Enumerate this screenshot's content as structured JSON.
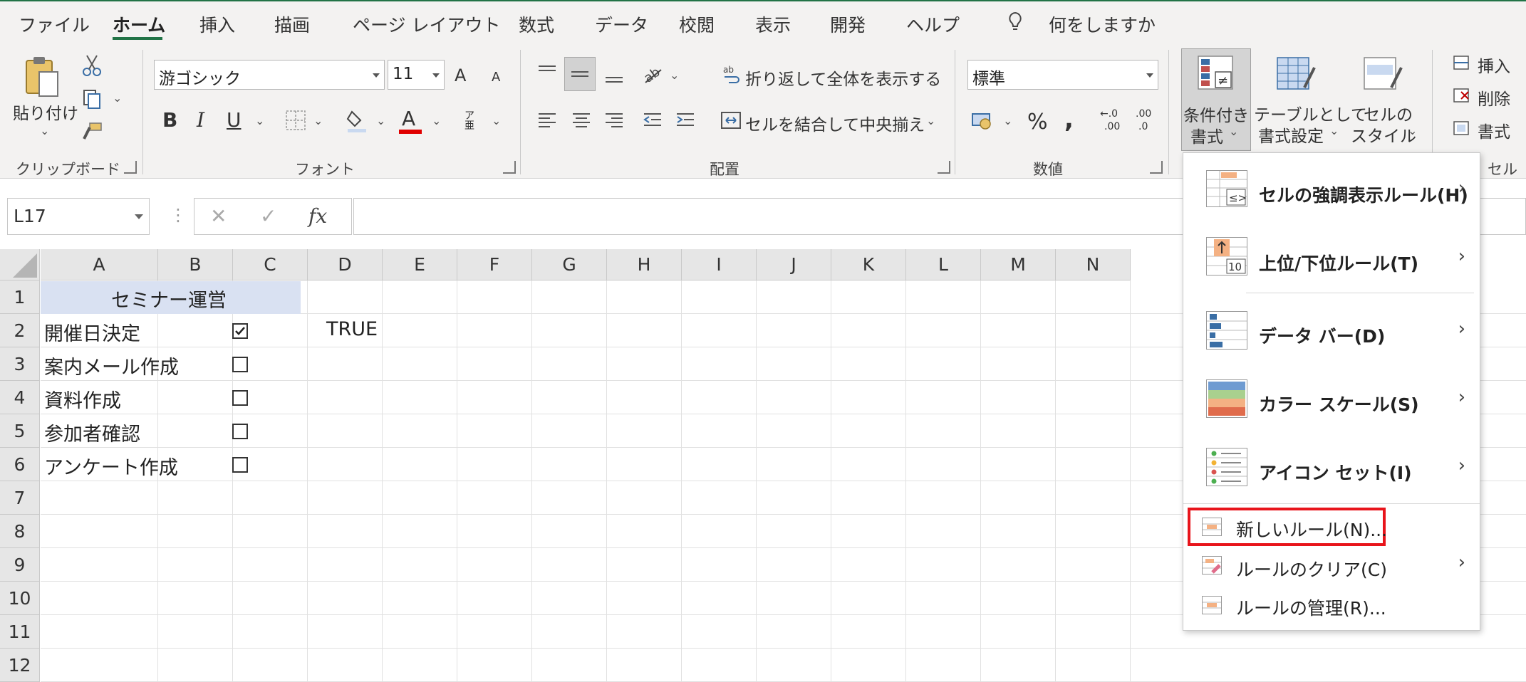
{
  "tabs": [
    "ファイル",
    "ホーム",
    "挿入",
    "描画",
    "ページ レイアウト",
    "数式",
    "データ",
    "校閲",
    "表示",
    "開発",
    "ヘルプ"
  ],
  "active_tab": "ホーム",
  "tell_me": "何をしますか",
  "ribbon": {
    "clipboard": {
      "paste": "貼り付け",
      "label": "クリップボード"
    },
    "font": {
      "name": "游ゴシック",
      "size": "11",
      "label": "フォント",
      "bold": "B",
      "italic": "I",
      "underline": "U",
      "grow": "A",
      "shrink": "A",
      "font_color": "A",
      "phonetic": "ア亜"
    },
    "alignment": {
      "wrap": "折り返して全体を表示する",
      "merge": "セルを結合して中央揃え",
      "label": "配置"
    },
    "number": {
      "format": "標準",
      "percent": "%",
      "comma": ",",
      "inc_decimal": ".00",
      "dec_decimal": ".0",
      "label": "数値"
    },
    "styles": {
      "cond_format_1": "条件付き",
      "cond_format_2": "書式",
      "table_1": "テーブルとして",
      "table_2": "書式設定",
      "cell_1": "セルの",
      "cell_2": "スタイル"
    },
    "cells": {
      "insert": "挿入",
      "delete": "削除",
      "format": "書式",
      "label": "セル"
    }
  },
  "formula_bar": {
    "name_box": "L17",
    "fx": "fx",
    "cancel": "✕",
    "enter": "✓",
    "formula": ""
  },
  "columns": [
    "A",
    "B",
    "C",
    "D",
    "E",
    "F",
    "G",
    "H",
    "I",
    "J",
    "K",
    "L",
    "M",
    "N"
  ],
  "rows": [
    "1",
    "2",
    "3",
    "4",
    "5",
    "6",
    "7",
    "8",
    "9",
    "10",
    "11",
    "12"
  ],
  "cells": {
    "A1": "セミナー運営",
    "A2": "開催日決定",
    "A3": "案内メール作成",
    "A4": "資料作成",
    "A5": "参加者確認",
    "A6": "アンケート作成",
    "C2": "TRUE"
  },
  "checkboxes": [
    true,
    false,
    false,
    false,
    false
  ],
  "menu": {
    "items": [
      {
        "label": "セルの強調表示ルール(H)",
        "submenu": true
      },
      {
        "label": "上位/下位ルール(T)",
        "submenu": true
      },
      {
        "label": "データ バー(D)",
        "submenu": true
      },
      {
        "label": "カラー スケール(S)",
        "submenu": true
      },
      {
        "label": "アイコン セット(I)",
        "submenu": true
      },
      {
        "label": "新しいルール(N)...",
        "submenu": false,
        "highlighted": true
      },
      {
        "label": "ルールのクリア(C)",
        "submenu": true
      },
      {
        "label": "ルールの管理(R)...",
        "submenu": false
      }
    ],
    "highlight_color": "#e8141b"
  },
  "colors": {
    "accent": "#217346",
    "a1_fill": "#d9e1f2",
    "ribbon_bg": "#f3f2f1"
  }
}
